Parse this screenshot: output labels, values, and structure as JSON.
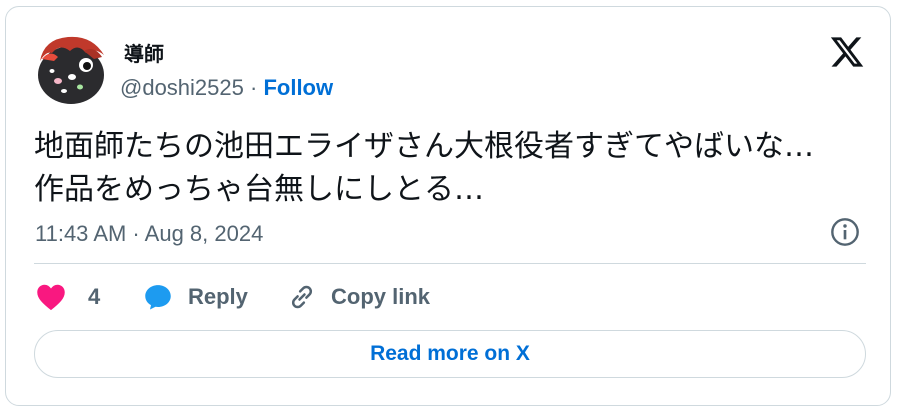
{
  "author": {
    "name": "導師",
    "handle": "@doshi2525",
    "separator": "·",
    "follow_label": "Follow"
  },
  "tweet": {
    "text_line1": "地面師たちの池田エライザさん大根役者すぎてやばいな…",
    "text_line2": "作品をめっちゃ台無しにしとる…",
    "timestamp": "11:43 AM · Aug 8, 2024"
  },
  "actions": {
    "like_count": "4",
    "reply_label": "Reply",
    "copy_link_label": "Copy link"
  },
  "footer": {
    "read_more_label": "Read more on X"
  },
  "colors": {
    "text": "#0f1419",
    "secondary": "#536471",
    "link": "#006fd6",
    "like": "#f91880",
    "reply_icon": "#1d9bf0",
    "border": "#cfd9de"
  },
  "icons": {
    "brand": "x-logo-icon",
    "info": "info-icon",
    "like": "heart-icon",
    "reply": "speech-bubble-icon",
    "copy": "link-icon"
  }
}
